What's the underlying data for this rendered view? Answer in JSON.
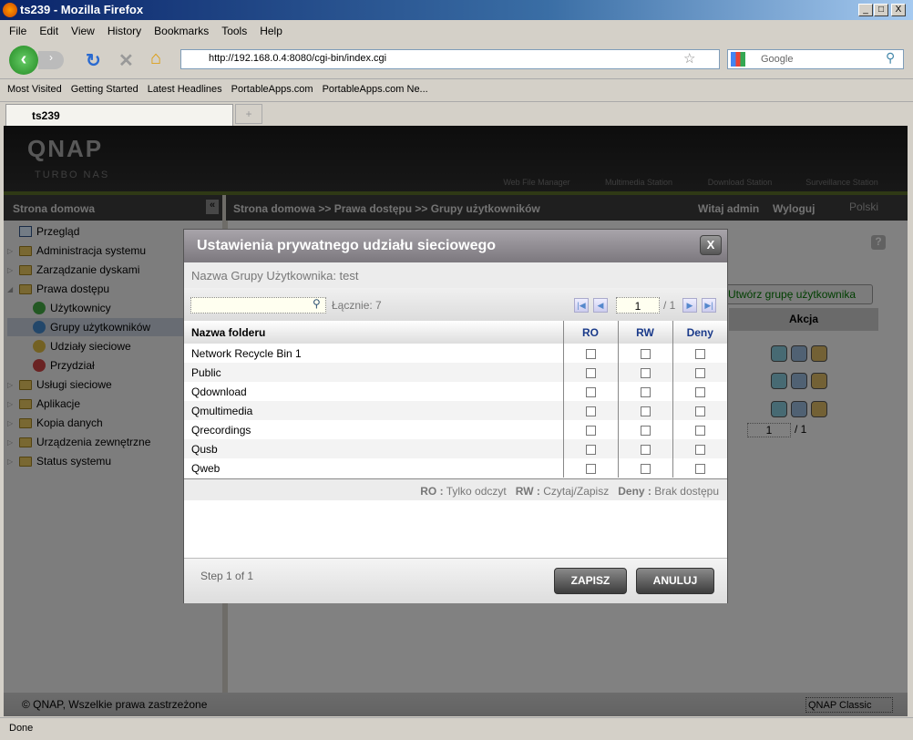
{
  "window": {
    "title": "ts239 - Mozilla Firefox",
    "min": "_",
    "max": "□",
    "close": "X"
  },
  "menu": [
    "File",
    "Edit",
    "View",
    "History",
    "Bookmarks",
    "Tools",
    "Help"
  ],
  "url": "http://192.168.0.4:8080/cgi-bin/index.cgi",
  "search_placeholder": "Google",
  "bookmarks": [
    "Most Visited",
    "Getting Started",
    "Latest Headlines",
    "PortableApps.com",
    "PortableApps.com Ne..."
  ],
  "tab": {
    "title": "ts239",
    "new": "+"
  },
  "qnap": {
    "logo": "QNAP",
    "subtitle": "TURBO NAS",
    "apps": [
      "Web File Manager",
      "Multimedia Station",
      "Download Station",
      "Surveillance Station"
    ]
  },
  "sidebar": {
    "title": "Strona domowa",
    "collapse": "«",
    "items": [
      {
        "label": "Przegląd",
        "level": 0
      },
      {
        "label": "Administracja systemu",
        "level": 0
      },
      {
        "label": "Zarządzanie dyskami",
        "level": 0
      },
      {
        "label": "Prawa dostępu",
        "level": 0,
        "expanded": true
      },
      {
        "label": "Użytkownicy",
        "level": 1
      },
      {
        "label": "Grupy użytkowników",
        "level": 1,
        "selected": true
      },
      {
        "label": "Udziały sieciowe",
        "level": 1
      },
      {
        "label": "Przydział",
        "level": 1
      },
      {
        "label": "Usługi sieciowe",
        "level": 0
      },
      {
        "label": "Aplikacje",
        "level": 0
      },
      {
        "label": "Kopia danych",
        "level": 0
      },
      {
        "label": "Urządzenia zewnętrzne",
        "level": 0
      },
      {
        "label": "Status systemu",
        "level": 0
      }
    ]
  },
  "breadcrumb": "Strona domowa >> Prawa dostępu >> Grupy użytkowników",
  "welcome": "Witaj admin",
  "logout": "Wyloguj",
  "language": "Polski",
  "bg": {
    "create_group": "Utwórz grupę użytkownika",
    "action_header": "Akcja",
    "page": "1",
    "page_total": "/ 1",
    "help": "?"
  },
  "footer": {
    "copyright": "© QNAP, Wszelkie prawa zastrzeżone",
    "theme": "QNAP Classic"
  },
  "status": "Done",
  "modal": {
    "title": "Ustawienia prywatnego udziału sieciowego",
    "close": "X",
    "group_label": "Nazwa Grupy Użytkownika: test",
    "search_value": "",
    "total": "Łącznie:  7",
    "page": "1",
    "page_total": "/ 1",
    "columns": [
      "Nazwa folderu",
      "RO",
      "RW",
      "Deny"
    ],
    "rows": [
      {
        "name": "Network Recycle Bin 1",
        "ro": false,
        "rw": false,
        "deny": false
      },
      {
        "name": "Public",
        "ro": false,
        "rw": false,
        "deny": false
      },
      {
        "name": "Qdownload",
        "ro": false,
        "rw": false,
        "deny": false
      },
      {
        "name": "Qmultimedia",
        "ro": false,
        "rw": false,
        "deny": false
      },
      {
        "name": "Qrecordings",
        "ro": false,
        "rw": false,
        "deny": false
      },
      {
        "name": "Qusb",
        "ro": false,
        "rw": false,
        "deny": false
      },
      {
        "name": "Qweb",
        "ro": false,
        "rw": false,
        "deny": false
      }
    ],
    "legend": [
      {
        "k": "RO :",
        "v": "Tylko odczyt"
      },
      {
        "k": "RW :",
        "v": "Czytaj/Zapisz"
      },
      {
        "k": "Deny :",
        "v": "Brak dostępu"
      }
    ],
    "step": "Step 1 of 1",
    "save": "ZAPISZ",
    "cancel": "ANULUJ"
  }
}
